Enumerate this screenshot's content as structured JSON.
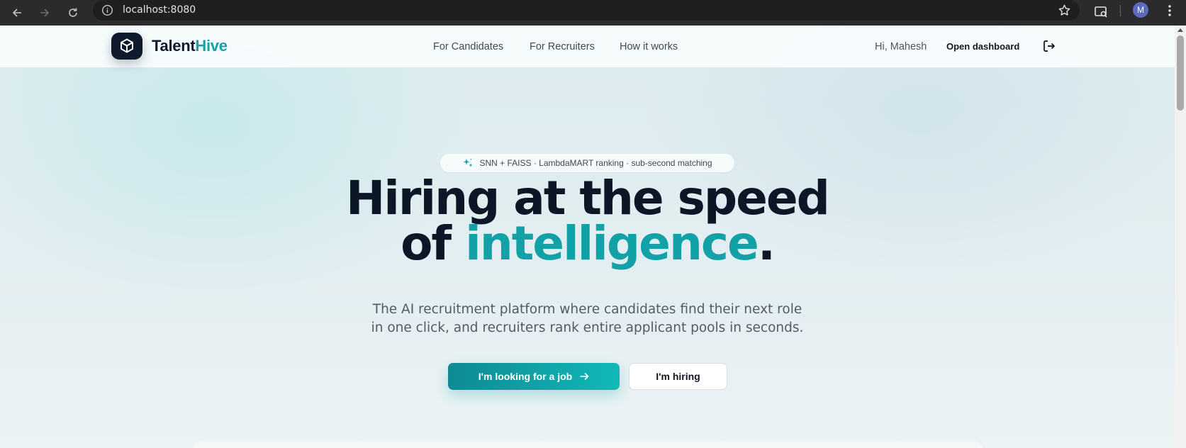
{
  "browser": {
    "url": "localhost:8080",
    "profile_initial": "M",
    "icons": [
      "back-arrow-icon",
      "forward-arrow-icon",
      "reload-icon",
      "info-icon",
      "star-icon",
      "extension-icon",
      "kebab-menu-icon"
    ]
  },
  "header": {
    "brand_part1": "Talent",
    "brand_part2": "Hive",
    "nav": [
      "For Candidates",
      "For Recruiters",
      "How it works"
    ],
    "greeting": "Hi, Mahesh",
    "dashboard_label": "Open dashboard"
  },
  "hero": {
    "pill_text": "SNN + FAISS · LambdaMART ranking · sub-second matching",
    "headline_line1": "Hiring at the speed",
    "headline_of": "of",
    "headline_accent": "intelligence",
    "headline_period": ".",
    "subtitle_line1": "The AI recruitment platform where candidates find their next role",
    "subtitle_line2": "in one click, and recruiters rank entire applicant pools in seconds.",
    "cta_primary": "I'm looking for a job",
    "cta_secondary": "I'm hiring"
  },
  "colors": {
    "accent": "#11a1a6",
    "navy": "#0f1b2d"
  }
}
